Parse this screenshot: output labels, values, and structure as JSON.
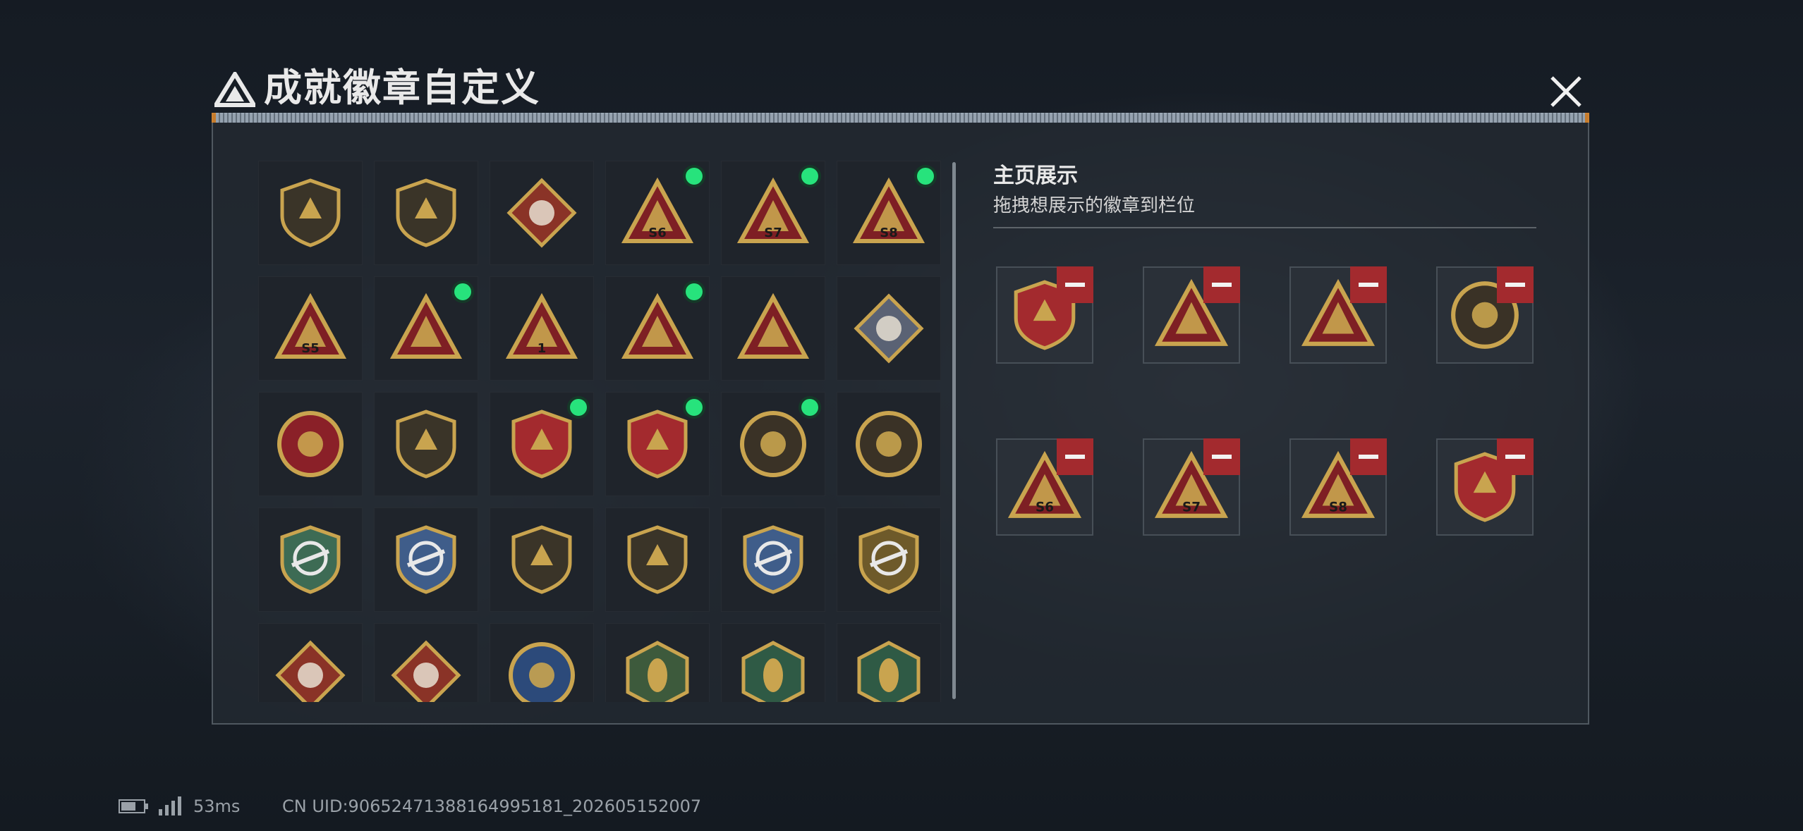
{
  "header": {
    "title": "成就徽章自定义",
    "close_icon": "close-icon",
    "logo_icon": "delta-logo-icon"
  },
  "badge_grid": {
    "rows": [
      [
        {
          "icon": "delta-shield-badge-icon",
          "equipped": false
        },
        {
          "icon": "helicopter-shield-badge-icon",
          "equipped": false
        },
        {
          "icon": "diamond-emblem-shield-badge-icon",
          "equipped": false
        },
        {
          "icon": "season-s6-triangle-badge-icon",
          "label": "S6",
          "equipped": true
        },
        {
          "icon": "season-s7-triangle-badge-icon",
          "label": "S7",
          "equipped": true
        },
        {
          "icon": "season-s8-triangle-badge-icon",
          "label": "S8",
          "equipped": true
        }
      ],
      [
        {
          "icon": "season-s5-triangle-badge-icon",
          "label": "S5",
          "equipped": false
        },
        {
          "icon": "egg-nest-triangle-badge-icon",
          "equipped": true
        },
        {
          "icon": "number-one-triangle-badge-icon",
          "label": "1",
          "equipped": false
        },
        {
          "icon": "hands-triangle-badge-icon",
          "equipped": true
        },
        {
          "icon": "soldiers-triangle-badge-icon",
          "equipped": false
        },
        {
          "icon": "rose-diamond-badge-icon",
          "equipped": false
        }
      ],
      [
        {
          "icon": "star-medal-badge-icon",
          "equipped": false
        },
        {
          "icon": "chevron-shield-badge-icon",
          "equipped": false
        },
        {
          "icon": "laurel-shield-badge-icon",
          "equipped": true
        },
        {
          "icon": "star-laurel-shield-badge-icon",
          "equipped": true
        },
        {
          "icon": "pearl-circle-badge-icon",
          "equipped": true
        },
        {
          "icon": "skull-circle-badge-icon",
          "equipped": false
        }
      ],
      [
        {
          "icon": "rifle-crosshair-green-badge-icon",
          "equipped": false
        },
        {
          "icon": "rifle-crosshair-blue-badge-icon",
          "equipped": false
        },
        {
          "icon": "rifle-gold-shield-badge-icon",
          "equipped": false
        },
        {
          "icon": "sniper-gold-shield-badge-icon",
          "equipped": false
        },
        {
          "icon": "smg-crosshair-badge-icon",
          "equipped": false
        },
        {
          "icon": "gold-crosshair-badge-icon",
          "equipped": false
        }
      ],
      [
        {
          "icon": "wolf-red-diamond-badge-icon",
          "equipped": false
        },
        {
          "icon": "wolf-diamond-badge-icon",
          "equipped": false
        },
        {
          "icon": "eagle-circle-badge-icon",
          "equipped": false
        },
        {
          "icon": "wasp-hexagon-badge-icon",
          "equipped": false
        },
        {
          "icon": "wasp-green-hexagon-badge-icon",
          "equipped": false
        },
        {
          "icon": "medic-hexagon-badge-icon",
          "equipped": false
        }
      ]
    ]
  },
  "showcase": {
    "title": "主页展示",
    "subtitle": "拖拽想展示的徽章到栏位",
    "slots": [
      {
        "icon": "laurel-shield-badge-icon"
      },
      {
        "icon": "egg-nest-triangle-badge-icon"
      },
      {
        "icon": "hands-triangle-badge-icon"
      },
      {
        "icon": "pearl-circle-badge-icon"
      },
      {
        "icon": "season-s6-triangle-badge-icon",
        "label": "S6"
      },
      {
        "icon": "season-s7-triangle-badge-icon",
        "label": "S7"
      },
      {
        "icon": "season-s8-triangle-badge-icon",
        "label": "S8"
      },
      {
        "icon": "star-laurel-shield-badge-icon"
      }
    ],
    "remove_icon": "minus-icon"
  },
  "status_bar": {
    "battery_icon": "battery-icon",
    "signal_icon": "signal-icon",
    "ping": "53ms",
    "uid": "CN UID:90652471388164995181_202605152007"
  },
  "colors": {
    "equipped_dot": "#27e37c",
    "remove_button": "#a32a2e",
    "badge_gold": "#c9a44f"
  }
}
